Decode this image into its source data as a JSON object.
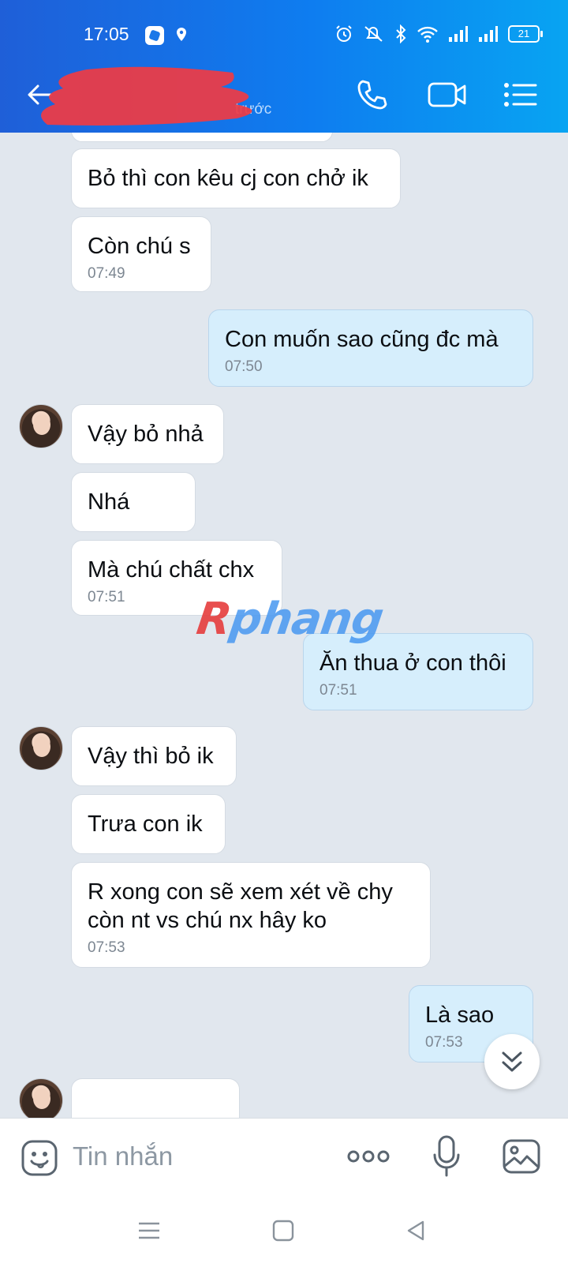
{
  "status": {
    "time": "17:05",
    "battery": "21"
  },
  "header": {
    "title_redacted": "",
    "subtitle": "trước"
  },
  "messages": [
    {
      "dir": "in",
      "text": "Bỏ thì con kêu cj con chở ik",
      "time": ""
    },
    {
      "dir": "in",
      "text": "Còn chú s",
      "time": "07:49"
    },
    {
      "dir": "out",
      "text": "Con muốn sao cũng đc mà",
      "time": "07:50"
    },
    {
      "dir": "in",
      "text": "Vậy bỏ nhả",
      "time": ""
    },
    {
      "dir": "in",
      "text": "Nhá",
      "time": ""
    },
    {
      "dir": "in",
      "text": "Mà chú chất chx",
      "time": "07:51"
    },
    {
      "dir": "out",
      "text": "Ăn thua ở con thôi",
      "time": "07:51"
    },
    {
      "dir": "in",
      "text": "Vậy thì bỏ ik",
      "time": ""
    },
    {
      "dir": "in",
      "text": "Trưa con ik",
      "time": ""
    },
    {
      "dir": "in",
      "text": "R xong con sẽ xem xét về chy còn nt vs chú nx hây ko",
      "time": "07:53"
    },
    {
      "dir": "out",
      "text": "Là sao",
      "time": "07:53"
    }
  ],
  "watermark": {
    "r": "R",
    "rest": "phang"
  },
  "input": {
    "placeholder": "Tin nhắn",
    "value": ""
  },
  "icons": {
    "back": "back-arrow-icon",
    "call": "phone-icon",
    "video": "video-call-icon",
    "menu": "list-menu-icon",
    "emoji": "emoji-icon",
    "more": "more-dots-icon",
    "mic": "microphone-icon",
    "image": "image-icon",
    "scroll": "chevron-double-down-icon"
  },
  "colors": {
    "header_start": "#1f5fd8",
    "header_end": "#08a4f2",
    "out_bubble": "#d6eefc",
    "background": "#e1e7ee"
  }
}
